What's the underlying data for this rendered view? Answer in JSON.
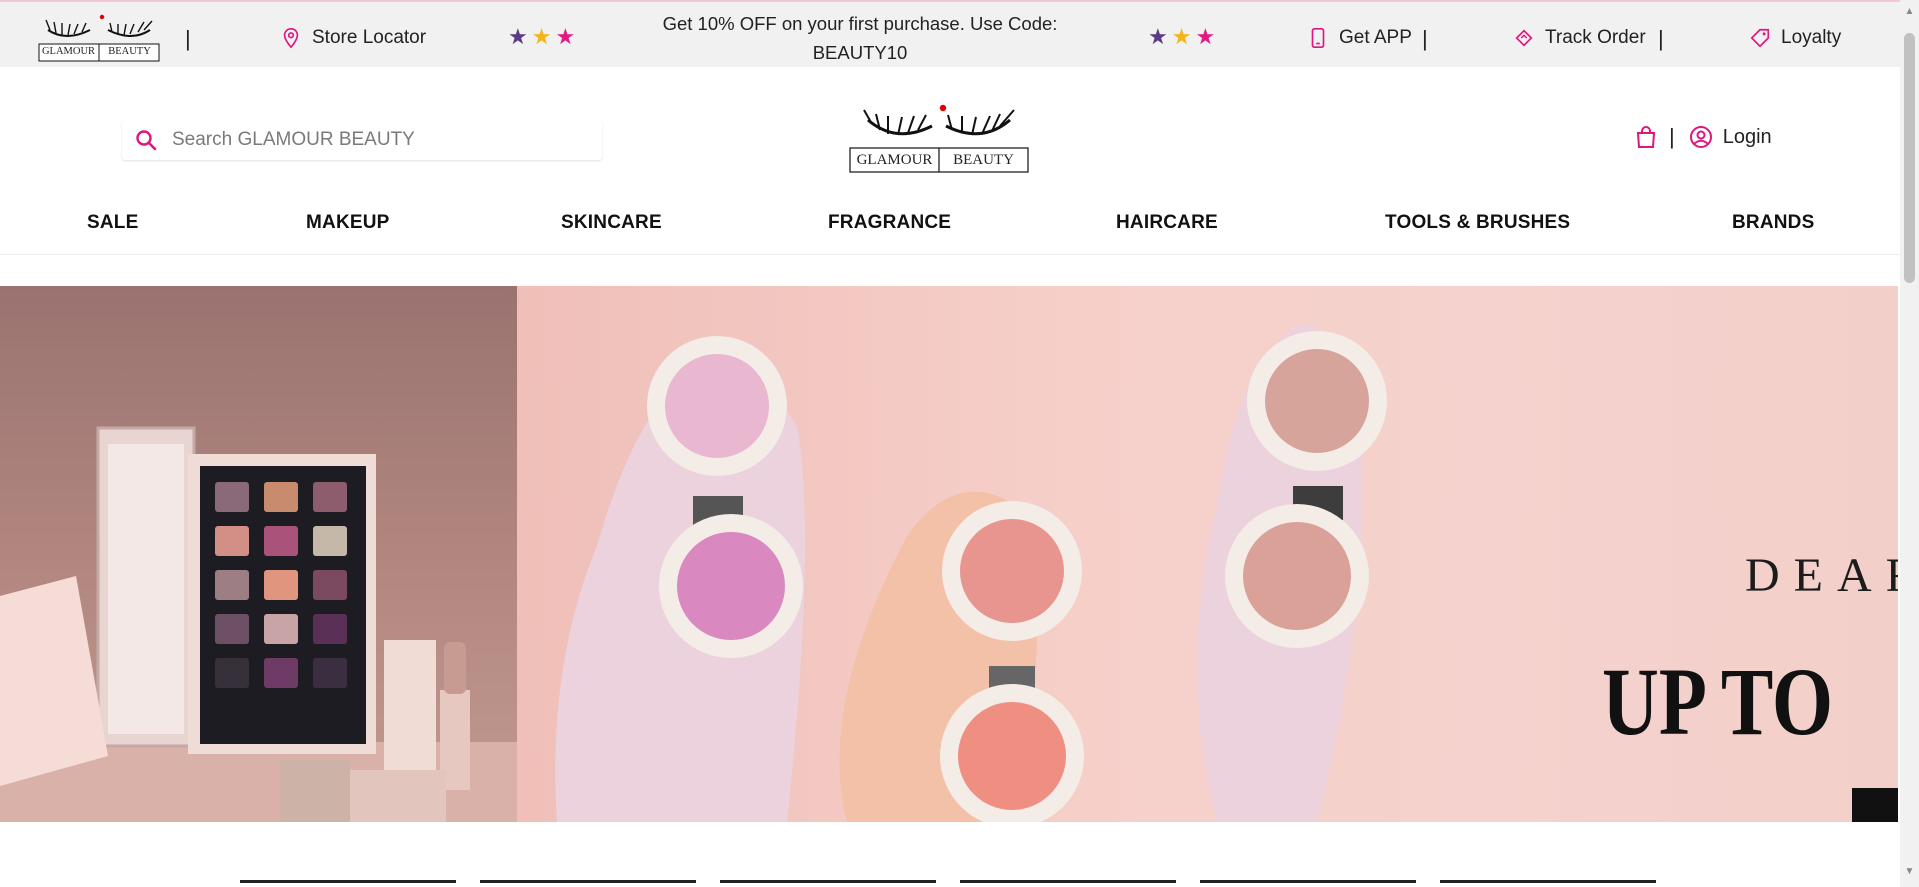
{
  "topbar": {
    "logo_text_left": "GLAMOUR",
    "logo_text_right": "BEAUTY",
    "store_locator": "Store Locator",
    "promo_line1": "Get 10% OFF on your first purchase. Use Code:",
    "promo_line2": "BEAUTY10",
    "get_app": "Get APP",
    "track_order": "Track Order",
    "loyalty": "Loyalty",
    "separator": "|",
    "stars": [
      "★",
      "★",
      "★"
    ],
    "star_colors": [
      "#5b3a86",
      "#f2b51c",
      "#e11b82"
    ]
  },
  "header": {
    "search_placeholder": "Search GLAMOUR BEAUTY",
    "logo_text_left": "GLAMOUR",
    "logo_text_right": "BEAUTY",
    "login": "Login",
    "separator": "|",
    "accent_color": "#e0157f"
  },
  "nav": {
    "items": [
      "SALE",
      "MAKEUP",
      "SKINCARE",
      "FRAGRANCE",
      "HAIRCARE",
      "TOOLS & BRUSHES",
      "BRANDS"
    ]
  },
  "hero": {
    "headline_small": "DEAR",
    "headline_large": "UP TO"
  },
  "scrollbar": {
    "up": "▲",
    "down": "▼"
  }
}
